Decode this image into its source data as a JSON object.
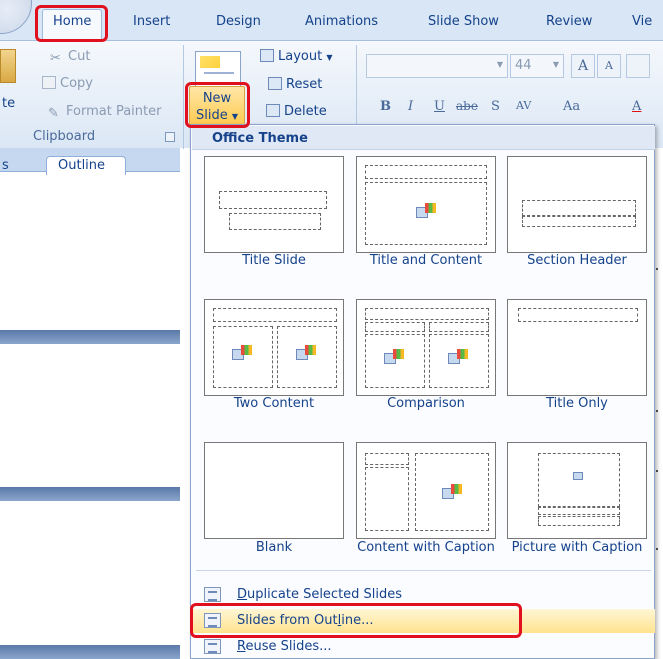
{
  "tabs": [
    "Home",
    "Insert",
    "Design",
    "Animations",
    "Slide Show",
    "Review",
    "Vie"
  ],
  "clipboard": {
    "paste_partial": "te",
    "cut": "Cut",
    "copy": "Copy",
    "format_painter": "Format Painter",
    "group_label": "Clipboard"
  },
  "slides_group": {
    "new_slide_line1": "New",
    "new_slide_line2": "Slide",
    "layout": "Layout",
    "reset": "Reset",
    "delete": "Delete"
  },
  "font_group": {
    "size": "44",
    "bold": "B",
    "italic": "I",
    "underline": "U",
    "strike": "abe",
    "shadow": "S",
    "spacing": "AV",
    "change_case": "Aa",
    "font_color": "A"
  },
  "panes": {
    "slides_partial": "s",
    "outline": "Outline"
  },
  "menu": {
    "header": "Office Theme",
    "layouts": [
      "Title Slide",
      "Title and Content",
      "Section Header",
      "Two Content",
      "Comparison",
      "Title Only",
      "Blank",
      "Content with Caption",
      "Picture with Caption"
    ],
    "items": {
      "duplicate_hot": "D",
      "duplicate_rest": "uplicate Selected Slides",
      "outline_a": "Slides from Out",
      "outline_hot": "l",
      "outline_b": "ine...",
      "reuse_hot": "R",
      "reuse_rest": "euse Slides..."
    }
  },
  "colors": {
    "accent_text": "#15428b",
    "ribbon_bg": "#dbe7f5",
    "highlight": "#ffe38f",
    "callout_red": "#e0101e"
  }
}
